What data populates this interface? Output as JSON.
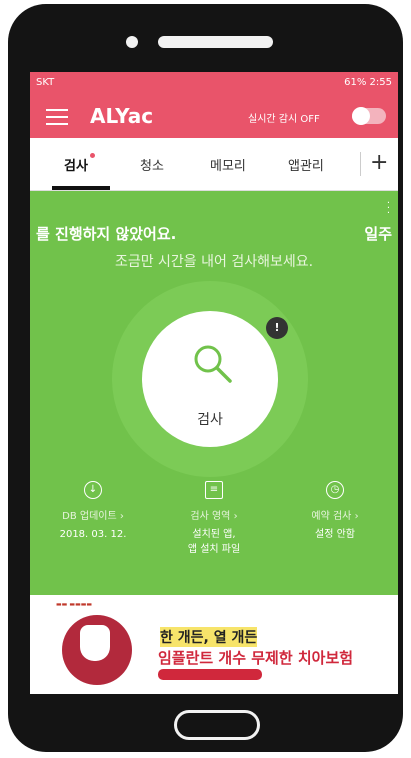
{
  "status_bar": {
    "carrier": "SKT",
    "right": "61% 2:55"
  },
  "app_bar": {
    "title": "ALYac",
    "realtime_label": "실시간 감시 OFF"
  },
  "tabs": [
    {
      "label": "검사",
      "active": true
    },
    {
      "label": "청소",
      "active": false
    },
    {
      "label": "메모리",
      "active": false
    },
    {
      "label": "앱관리",
      "active": false
    }
  ],
  "add_tab_label": "+",
  "main": {
    "headline": "를 진행하지 않았어요.",
    "headline_right": "일주",
    "subline": "조금만 시간을 내어 검사해보세요.",
    "badge": "!",
    "scan_label": "검사",
    "accent": "#71c24b"
  },
  "info": [
    {
      "title": "DB 업데이트 ›",
      "value": "2018. 03. 12."
    },
    {
      "title": "검사 영역 ›",
      "value": "설치된 앱,\n앱 설치 파일"
    },
    {
      "title": "예약 검사 ›",
      "value": "설정 안함"
    }
  ],
  "ad": {
    "line1": "한 개든, 열 개든",
    "line2": "임플란트 개수 무제한 치아보험"
  },
  "colors": {
    "brand": "#e9546a",
    "green": "#71c24b"
  }
}
